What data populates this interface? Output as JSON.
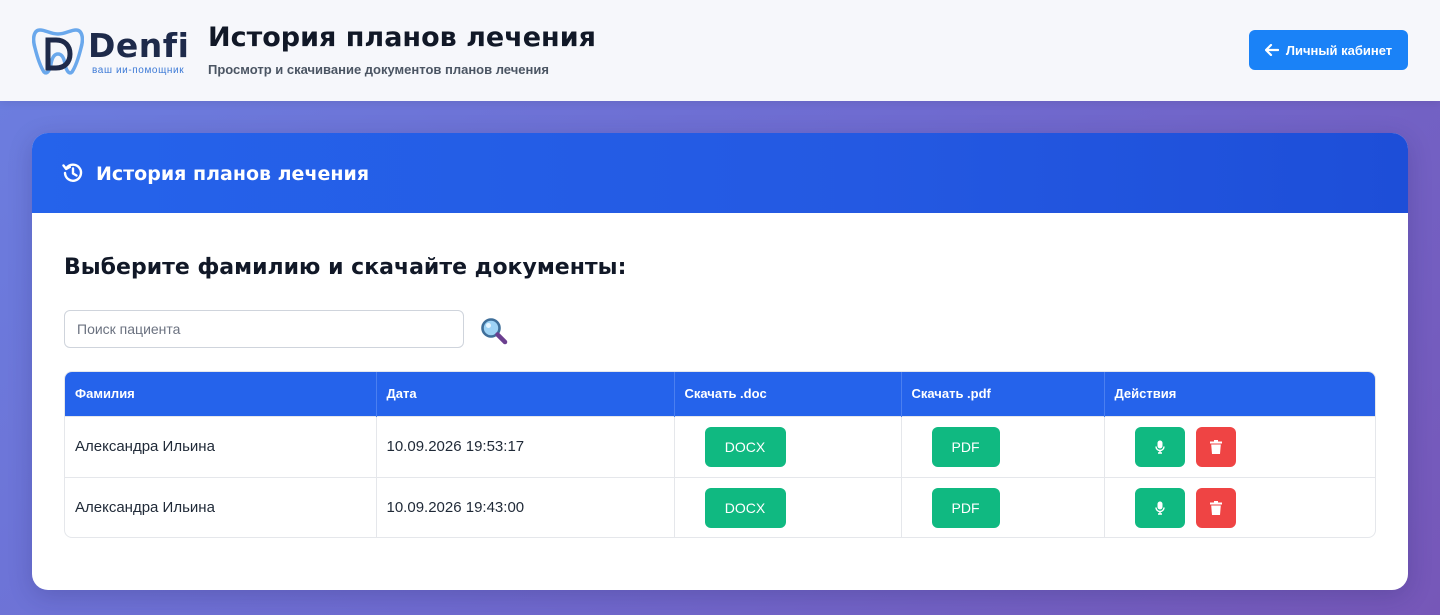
{
  "header": {
    "logo_word": "Denfi",
    "logo_tagline": "ваш ии-помощник",
    "title": "История планов лечения",
    "subtitle": "Просмотр и скачивание документов планов лечения",
    "cabinet_button": "Личный кабинет"
  },
  "card": {
    "title": "История планов лечения",
    "section_title": "Выберите фамилию и скачайте документы:",
    "search": {
      "placeholder": "Поиск пациента",
      "value": ""
    }
  },
  "table": {
    "columns": [
      "Фамилия",
      "Дата",
      "Скачать .doc",
      "Скачать .pdf",
      "Действия"
    ],
    "rows": [
      {
        "name": "Александра Ильина",
        "date": "10.09.2026 19:53:17",
        "doc_label": "DOCX",
        "pdf_label": "PDF"
      },
      {
        "name": "Александра Ильина",
        "date": "10.09.2026 19:43:00",
        "doc_label": "DOCX",
        "pdf_label": "PDF"
      }
    ]
  },
  "colors": {
    "accent_blue": "#2563eb",
    "button_blue": "#1a82f7",
    "success_green": "#10b981",
    "danger_red": "#ef4444"
  },
  "icons": {
    "logo": "tooth-logo-icon",
    "back": "arrow-left-icon",
    "history": "history-icon",
    "search": "magnifier-icon",
    "record": "microphone-icon",
    "delete": "trash-icon"
  }
}
